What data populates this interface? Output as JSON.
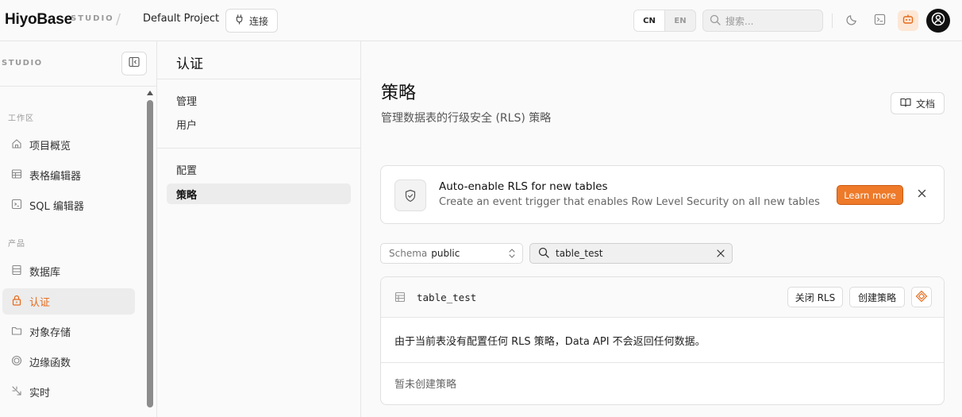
{
  "brand": {
    "logo": "HiyoBase",
    "studio_tag": "STUDIO",
    "separator": "/"
  },
  "header": {
    "project_name": "Default Project",
    "connect_label": "连接",
    "lang": {
      "cn": "CN",
      "en": "EN",
      "selected": "CN"
    },
    "search_placeholder": "搜索..."
  },
  "sidebar": {
    "title": "STUDIO",
    "sections": [
      {
        "label": "工作区",
        "items": [
          {
            "label": "项目概览",
            "icon": "home-icon"
          },
          {
            "label": "表格编辑器",
            "icon": "table-icon"
          },
          {
            "label": "SQL 编辑器",
            "icon": "terminal-icon"
          }
        ]
      },
      {
        "label": "产品",
        "items": [
          {
            "label": "数据库",
            "icon": "database-icon"
          },
          {
            "label": "认证",
            "icon": "lock-icon",
            "active": true
          },
          {
            "label": "对象存储",
            "icon": "folder-icon"
          },
          {
            "label": "边缘函数",
            "icon": "function-icon"
          },
          {
            "label": "实时",
            "icon": "realtime-icon"
          }
        ]
      }
    ]
  },
  "subnav": {
    "title": "认证",
    "groups": [
      {
        "items": [
          {
            "label": "管理"
          },
          {
            "label": "用户"
          }
        ]
      },
      {
        "items": [
          {
            "label": "配置"
          },
          {
            "label": "策略",
            "active": true
          }
        ]
      }
    ]
  },
  "main": {
    "title": "策略",
    "subtitle": "管理数据表的行级安全 (RLS) 策略",
    "docs_label": "文档",
    "banner": {
      "title": "Auto-enable RLS for new tables",
      "description": "Create an event trigger that enables Row Level Security on all new tables",
      "learn_more": "Learn more"
    },
    "schema_select": {
      "label": "Schema",
      "value": "public"
    },
    "table_search": {
      "value": "table_test"
    },
    "table_card": {
      "name": "table_test",
      "disable_rls": "关闭 RLS",
      "create_policy": "创建策略",
      "message": "由于当前表没有配置任何 RLS 策略，Data API 不会返回任何数据。",
      "empty": "暂未创建策略"
    }
  },
  "colors": {
    "accent": "#ee7a2a",
    "active_bg": "#ececec",
    "active_text": "#e56a1a"
  }
}
